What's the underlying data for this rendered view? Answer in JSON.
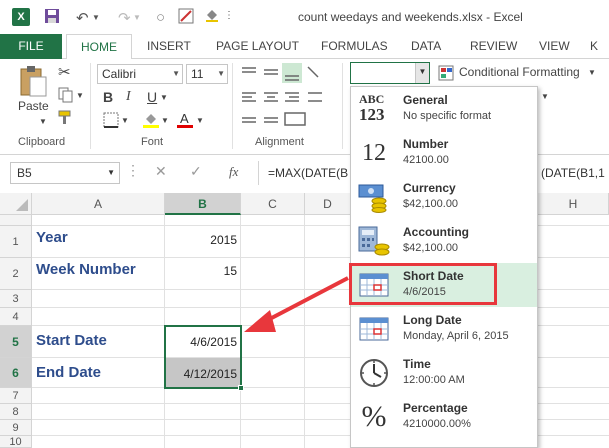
{
  "app": {
    "logo": "X",
    "title": "count weedays and weekends.xlsx - Excel"
  },
  "tabs": [
    "FILE",
    "HOME",
    "INSERT",
    "PAGE LAYOUT",
    "FORMULAS",
    "DATA",
    "REVIEW",
    "VIEW",
    "K"
  ],
  "ribbon": {
    "paste_label": "Paste",
    "font_name": "Calibri",
    "font_size": "11",
    "bold": "B",
    "italic": "I",
    "underline": "U",
    "cond_format": "Conditional Formatting",
    "groups": [
      "Clipboard",
      "Font",
      "Alignment"
    ]
  },
  "formula_bar": {
    "namebox": "B5",
    "fx": "fx",
    "formula_left": "=MAX(DATE(B",
    "formula_right": "(DATE(B1,1"
  },
  "grid": {
    "columns": [
      "A",
      "B",
      "C",
      "D",
      "H"
    ],
    "rows": [
      "1",
      "2",
      "3",
      "4",
      "5",
      "6",
      "7",
      "8",
      "9",
      "10"
    ],
    "cells": {
      "a1": "Year",
      "b1": "2015",
      "a2": "Week Number",
      "b2": "15",
      "a5": "Start Date",
      "b5": "4/6/2015",
      "a6": "End Date",
      "b6": "4/12/2015"
    }
  },
  "number_formats": [
    {
      "name": "General",
      "desc": "No specific format",
      "icon": "abc-123-icon"
    },
    {
      "name": "Number",
      "desc": "42100.00",
      "icon": "number-12-icon"
    },
    {
      "name": "Currency",
      "desc": "$42,100.00",
      "icon": "currency-icon"
    },
    {
      "name": "Accounting",
      "desc": " $42,100.00",
      "icon": "accounting-icon"
    },
    {
      "name": "Short Date",
      "desc": "4/6/2015",
      "icon": "calendar-icon"
    },
    {
      "name": "Long Date",
      "desc": "Monday, April 6, 2015",
      "icon": "calendar-icon"
    },
    {
      "name": "Time",
      "desc": "12:00:00 AM",
      "icon": "clock-icon"
    },
    {
      "name": "Percentage",
      "desc": "4210000.00%",
      "icon": "percent-icon"
    }
  ],
  "general_icon_text": {
    "top": "ABC",
    "bottom": "123"
  },
  "number_icon_text": "12",
  "percent_icon_text": "%",
  "colors": {
    "excel_green": "#217346",
    "label_blue": "#2e4d8c",
    "highlight_red": "#e8373c",
    "selected_fill": "#d9efe0"
  }
}
